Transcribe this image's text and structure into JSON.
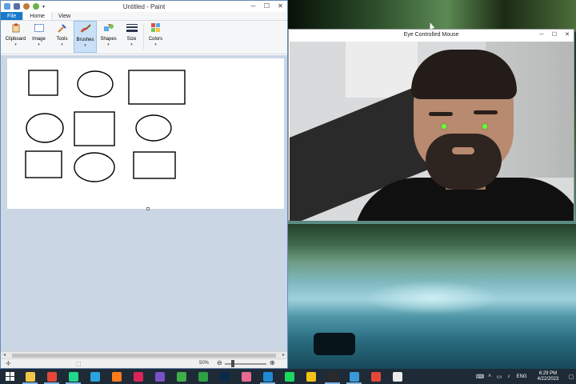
{
  "paint": {
    "title": "Untitled - Paint",
    "tabs": [
      "File",
      "Home",
      "View"
    ],
    "ribbon_groups": [
      {
        "label": "Clipboard",
        "icon": "clipboard-icon"
      },
      {
        "label": "Image",
        "icon": "image-icon"
      },
      {
        "label": "Tools",
        "icon": "tools-icon"
      },
      {
        "label": "Brushes",
        "icon": "brush-icon"
      },
      {
        "label": "Shapes",
        "icon": "shapes-icon"
      },
      {
        "label": "Size",
        "icon": "size-icon"
      },
      {
        "label": "Colors",
        "icon": "colors-icon"
      }
    ],
    "selected_group": "Brushes",
    "zoom": "50%"
  },
  "eye_window": {
    "title": "Eye Controlled Mouse"
  },
  "taskbar": {
    "apps": [
      {
        "name": "file-explorer",
        "color": "#f2c544"
      },
      {
        "name": "chrome",
        "color": "#e4473a"
      },
      {
        "name": "pycharm",
        "color": "#21d789"
      },
      {
        "name": "telegram",
        "color": "#2aa3df"
      },
      {
        "name": "firefox",
        "color": "#ff7a1a"
      },
      {
        "name": "camera",
        "color": "#d9245a"
      },
      {
        "name": "visual-studio",
        "color": "#7a52c7"
      },
      {
        "name": "camtasia",
        "color": "#3fae48"
      },
      {
        "name": "xbox",
        "color": "#2ea043"
      },
      {
        "name": "photoshop",
        "color": "#0b2a4a"
      },
      {
        "name": "paint-3d",
        "color": "#e86a92"
      },
      {
        "name": "vscode",
        "color": "#1f8ad2"
      },
      {
        "name": "spotify",
        "color": "#1ed760"
      },
      {
        "name": "sticky-notes",
        "color": "#f5c218"
      },
      {
        "name": "terminal",
        "color": "#2b2b2b"
      },
      {
        "name": "paint",
        "color": "#3a9ad9"
      },
      {
        "name": "camtasia-recorder",
        "color": "#e4473a"
      },
      {
        "name": "notepad",
        "color": "#eaeaea"
      }
    ],
    "language": "ENG",
    "time": "6:29 PM",
    "date": "4/22/2023"
  }
}
